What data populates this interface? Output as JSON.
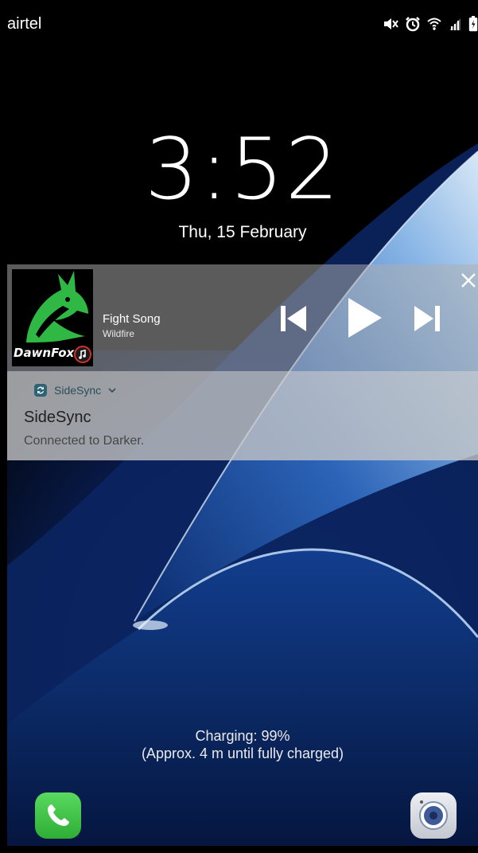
{
  "status_bar": {
    "carrier": "airtel",
    "icons": [
      "mute-icon",
      "alarm-icon",
      "wifi-icon",
      "signal-icon",
      "battery-icon"
    ]
  },
  "lock_screen": {
    "time": "3:52",
    "date": "Thu, 15 February"
  },
  "media_notification": {
    "album_brand": "DawnFox",
    "title": "Fight Song",
    "artist": "Wildfire",
    "controls": [
      "previous-icon",
      "play-icon",
      "next-icon"
    ],
    "dismiss_icon": "close-icon"
  },
  "notification": {
    "app_name": "SideSync",
    "title": "SideSync",
    "text": "Connected to Darker."
  },
  "charging": {
    "line1": "Charging: 99%",
    "line2": "(Approx. 4 m until fully charged)"
  },
  "shortcuts": {
    "left": "phone-icon",
    "right": "camera-icon"
  },
  "colors": {
    "media_card": "#afafaf",
    "notification_card": "#c8c8c8",
    "phone_green": "#3fc046",
    "sidesync_icon": "#2c6476"
  }
}
